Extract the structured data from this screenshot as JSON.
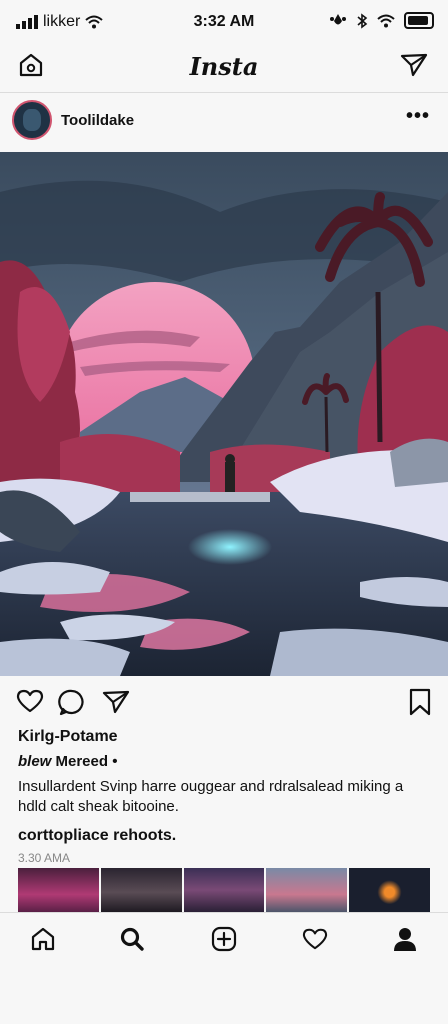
{
  "status_bar": {
    "carrier": "likker",
    "time": "3:32 AM"
  },
  "app": {
    "logo": "Insta"
  },
  "post": {
    "username": "Toolildake",
    "more_label": "•••",
    "caption_name": "Kirlg-Potame",
    "likes_prefix": "blew",
    "likes_rest": " Mereed •",
    "caption": "Insullardent Svinp harre ouggear and rdralsalead miking a hdld calt sheak bitooine.",
    "comment_heading": "corttopliace rehoots.",
    "timestamp": "3.30 AMA"
  },
  "colors": {
    "accent_ring": "#d0556f",
    "sun": "#f08bb0",
    "sky": "#2d3e50"
  },
  "icons": {
    "top_left": "home-outline-icon",
    "top_right": "send-icon",
    "like": "heart-outline-icon",
    "comment": "comment-bubble-icon",
    "share": "send-icon",
    "save": "bookmark-icon",
    "nav": [
      "home-icon",
      "search-icon",
      "add-post-icon",
      "heart-icon",
      "profile-icon"
    ]
  }
}
